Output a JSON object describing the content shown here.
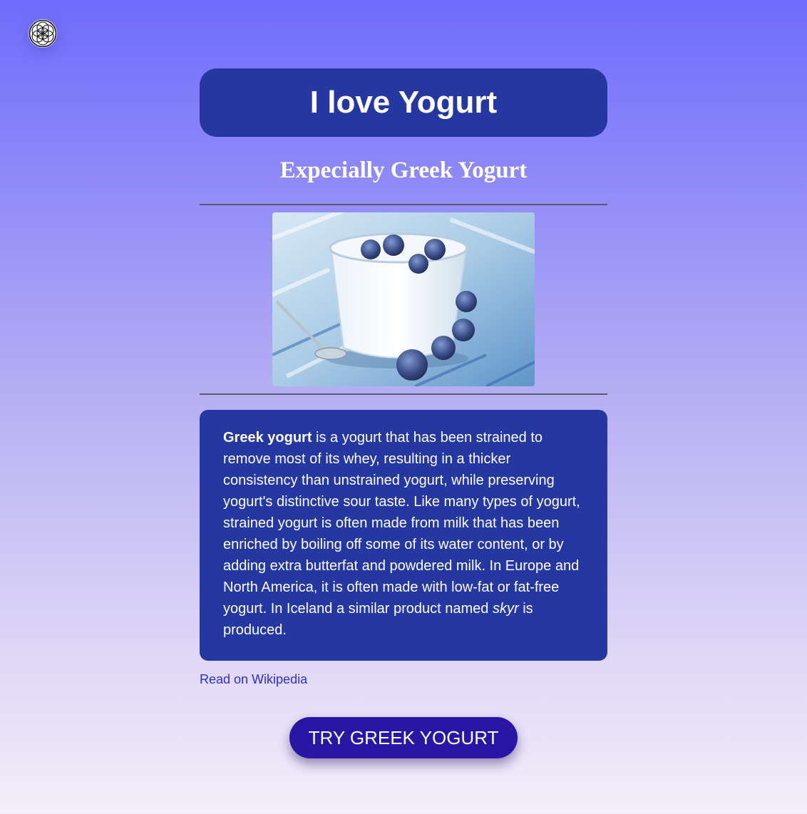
{
  "logo": {
    "icon": "flower-of-life-icon"
  },
  "header": {
    "title": "I love Yogurt",
    "subtitle": "Expecially Greek Yogurt"
  },
  "image": {
    "alt": "Greek yogurt with blueberries"
  },
  "description": {
    "bold_term": "Greek yogurt",
    "text_before_italic": " is a yogurt that has been strained to remove most of its whey, resulting in a thicker consistency than unstrained yogurt, while preserving yogurt's distinctive sour taste. Like many types of yogurt, strained yogurt is often made from milk that has been enriched by boiling off some of its water content, or by adding extra butterfat and powdered milk. In Europe and North America, it is often made with low-fat or fat-free yogurt. In Iceland a similar product named ",
    "italic_term": "skyr",
    "text_after_italic": " is produced."
  },
  "link": {
    "label": "Read on Wikipedia"
  },
  "cta": {
    "label": "TRY GREEK YOGURT"
  },
  "colors": {
    "card": "#2537a0",
    "cta": "#2915a6",
    "link": "#2f2fc9",
    "gradient_top": "#6f6cfd",
    "gradient_bottom": "#f4eefa"
  }
}
